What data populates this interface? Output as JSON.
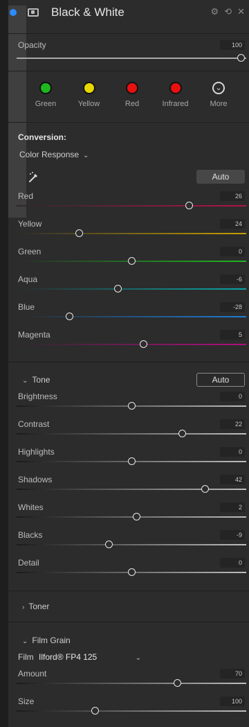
{
  "panel": {
    "title": "Black & White",
    "tool_icons": [
      "⚙",
      "⟲",
      "✕"
    ]
  },
  "opacity": {
    "label": "Opacity",
    "value": "100",
    "position": 1.0
  },
  "presets": [
    {
      "name": "Green",
      "color": "#1fb81f"
    },
    {
      "name": "Yellow",
      "color": "#e8d700"
    },
    {
      "name": "Red",
      "color": "#e81010"
    },
    {
      "name": "Infrared",
      "color": "#e81010"
    },
    {
      "name": "More",
      "icon": "chevron-down-circle-icon"
    }
  ],
  "conversion": {
    "title": "Conversion:",
    "response_label": "Color Response",
    "auto_label": "Auto",
    "sliders": [
      {
        "label": "Red",
        "value": "26",
        "position": 0.75,
        "color": "#b5134c"
      },
      {
        "label": "Yellow",
        "value": "24",
        "position": 0.27,
        "color": "#c7a000"
      },
      {
        "label": "Green",
        "value": "0",
        "position": 0.5,
        "color": "#1fb81f"
      },
      {
        "label": "Aqua",
        "value": "-6",
        "position": 0.44,
        "color": "#0aa6a6"
      },
      {
        "label": "Blue",
        "value": "-28",
        "position": 0.23,
        "color": "#1e7bd8"
      },
      {
        "label": "Magenta",
        "value": "5",
        "position": 0.55,
        "color": "#b20d80"
      }
    ]
  },
  "tone": {
    "title": "Tone",
    "auto_label": "Auto",
    "sliders": [
      {
        "label": "Brightness",
        "value": "0",
        "position": 0.5
      },
      {
        "label": "Contrast",
        "value": "22",
        "position": 0.72
      },
      {
        "label": "Highlights",
        "value": "0",
        "position": 0.5
      },
      {
        "label": "Shadows",
        "value": "42",
        "position": 0.82
      },
      {
        "label": "Whites",
        "value": "2",
        "position": 0.52
      },
      {
        "label": "Blacks",
        "value": "-9",
        "position": 0.4
      },
      {
        "label": "Detail",
        "value": "0",
        "position": 0.5
      }
    ]
  },
  "toner": {
    "title": "Toner"
  },
  "film_grain": {
    "title": "Film Grain",
    "film_label": "Film",
    "film_value": "Ilford® FP4 125",
    "sliders": [
      {
        "label": "Amount",
        "value": "70",
        "position": 0.7
      },
      {
        "label": "Size",
        "value": "100",
        "position": 0.34
      }
    ]
  }
}
